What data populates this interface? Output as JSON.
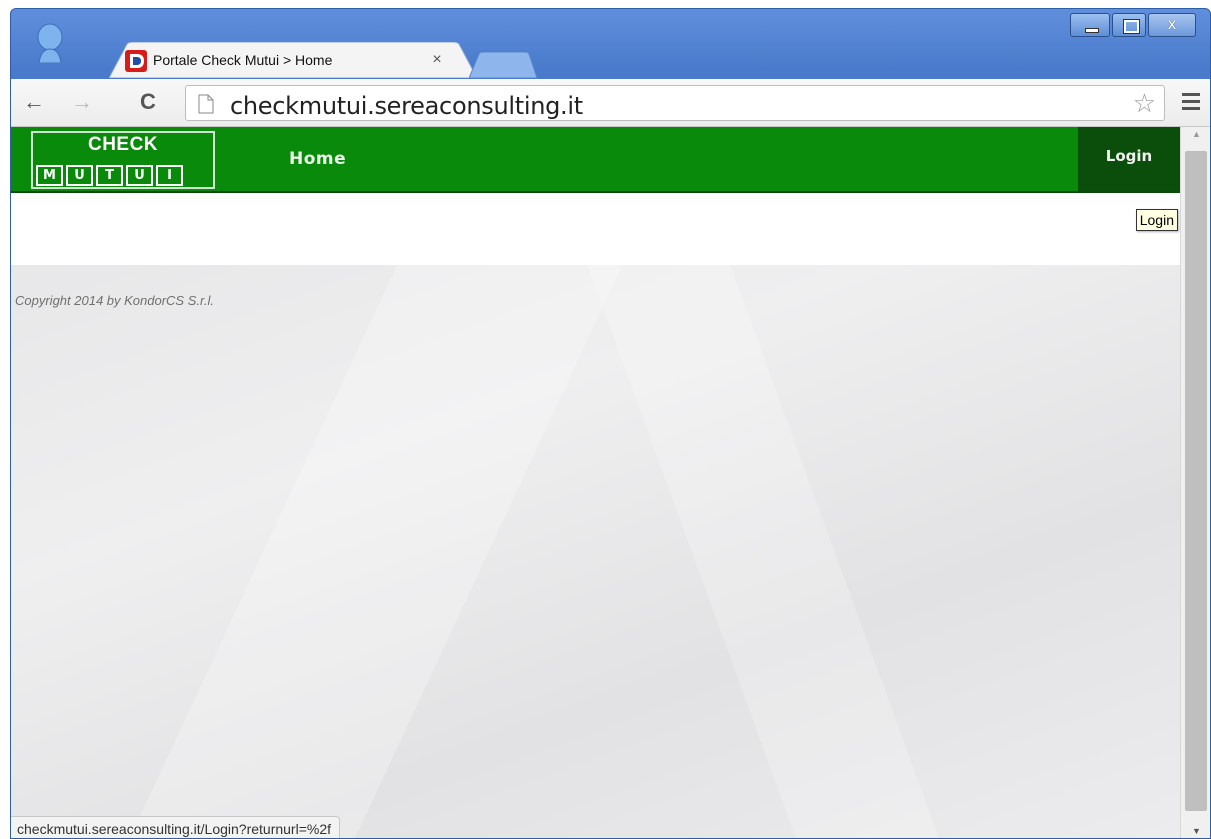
{
  "browser": {
    "tab": {
      "title": "Portale Check Mutui > Home",
      "close_glyph": "×"
    },
    "nav": {
      "back_glyph": "←",
      "forward_glyph": "→",
      "reload_glyph": "C"
    },
    "url": "checkmutui.sereaconsulting.it",
    "star_glyph": "☆",
    "window_close_glyph": "x",
    "status_url": "checkmutui.sereaconsulting.it/Login?returnurl=%2f"
  },
  "site": {
    "logo": {
      "top": "CHECK",
      "letters": [
        "M",
        "U",
        "T",
        "U",
        "I"
      ]
    },
    "nav": {
      "home": "Home",
      "login": "Login"
    },
    "tooltip": "Login",
    "copyright": "Copyright 2014 by KondorCS S.r.l."
  },
  "colors": {
    "nav_green": "#0a8a0a",
    "login_dark_green": "#0b4d0b",
    "chrome_blue": "#4a7acb"
  },
  "icons": {
    "profile": "person-silhouette-icon",
    "favicon": "portal-favicon-icon",
    "page": "page-icon",
    "bookmark": "star-icon",
    "menu": "hamburger-menu-icon"
  }
}
